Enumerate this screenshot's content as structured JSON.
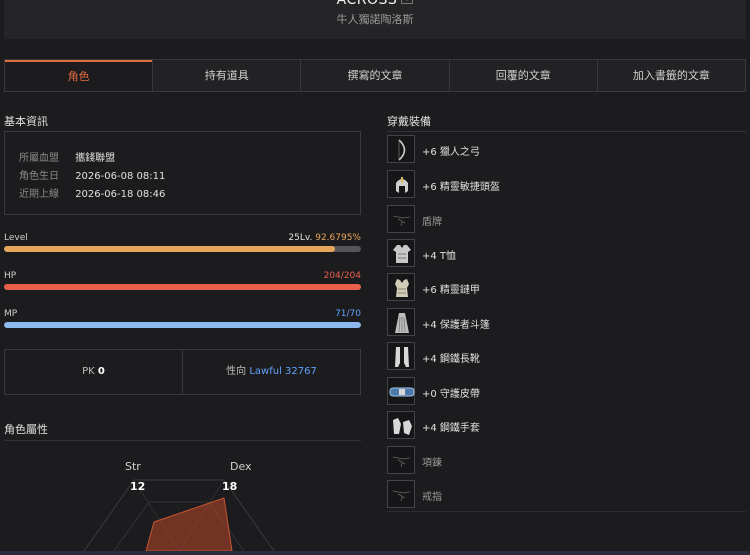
{
  "header": {
    "name": "ACROSS",
    "subtitle": "牛人獨諾陶洛斯"
  },
  "tabs": [
    {
      "label": "角色",
      "active": true
    },
    {
      "label": "持有道具"
    },
    {
      "label": "撰寫的文章"
    },
    {
      "label": "回覆的文章"
    },
    {
      "label": "加入書籤的文章"
    }
  ],
  "basic": {
    "title": "基本資訊",
    "rows": [
      {
        "key": "所屬血盟",
        "value": "攜錢聯盟"
      },
      {
        "key": "角色生日",
        "value": "2026-06-08 08:11"
      },
      {
        "key": "近期上線",
        "value": "2026-06-18 08:46"
      }
    ]
  },
  "level": {
    "label": "Level",
    "lv": "25Lv.",
    "pct": "92.6795%",
    "fraction": 0.927,
    "color": "#e8a65a"
  },
  "hp": {
    "label": "HP",
    "value": "204/204",
    "fraction": 1.0,
    "color": "#e8604c"
  },
  "mp": {
    "label": "MP",
    "value": "71/70",
    "fraction": 1.0,
    "color": "#8cb8f0"
  },
  "pk": {
    "label": "PK",
    "value": "0"
  },
  "alignment": {
    "label": "性向",
    "value": "Lawful 32767"
  },
  "attributes": {
    "title": "角色屬性",
    "str": {
      "label": "Str",
      "value": "12"
    },
    "dex": {
      "label": "Dex",
      "value": "18"
    }
  },
  "equipment": {
    "title": "穿戴裝備",
    "items": [
      {
        "name": "+6 獵人之弓",
        "icon": "bow-icon"
      },
      {
        "name": "+6 精靈敏捷頭盔",
        "icon": "helmet-icon"
      },
      {
        "name": "盾牌",
        "icon": "empty-slot-icon",
        "empty": true
      },
      {
        "name": "+4 T恤",
        "icon": "tshirt-icon"
      },
      {
        "name": "+6 精靈鏈甲",
        "icon": "chainmail-icon"
      },
      {
        "name": "+4 保護者斗篷",
        "icon": "cloak-icon"
      },
      {
        "name": "+4 鋼鐵長靴",
        "icon": "boots-icon"
      },
      {
        "name": "+0 守護皮帶",
        "icon": "belt-icon"
      },
      {
        "name": "+4 鋼鐵手套",
        "icon": "gloves-icon"
      },
      {
        "name": "項鍊",
        "icon": "empty-slot-icon",
        "empty": true
      },
      {
        "name": "戒指",
        "icon": "empty-slot-icon",
        "empty": true
      }
    ]
  }
}
